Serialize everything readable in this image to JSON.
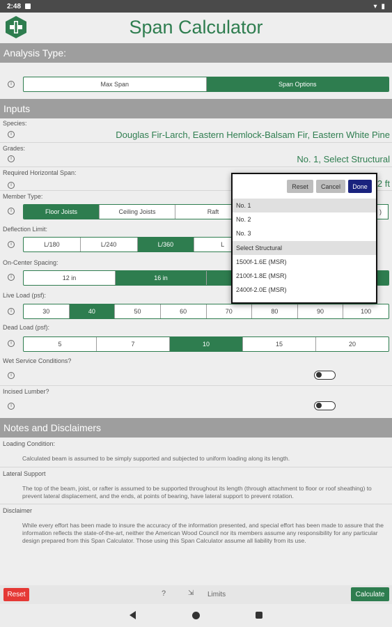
{
  "status": {
    "time": "2:48"
  },
  "app": {
    "title": "Span Calculator"
  },
  "sections": {
    "analysis": "Analysis Type:",
    "inputs": "Inputs",
    "notes": "Notes and Disclaimers"
  },
  "analysis_type": {
    "options": [
      "Max Span",
      "Span Options"
    ],
    "selected": "Span Options"
  },
  "species": {
    "label": "Species:",
    "value": "Douglas Fir-Larch, Eastern Hemlock-Balsam Fir, Eastern White Pine"
  },
  "grades": {
    "label": "Grades:",
    "value": "No. 1, Select Structural"
  },
  "horizontal_span": {
    "label": "Required Horizontal Span:",
    "value_suffix": "2 ft"
  },
  "member_type": {
    "label": "Member Type:",
    "options": [
      "Floor Joists",
      "Ceiling Joists",
      "Raft"
    ],
    "selected": "Floor Joists",
    "trailing_partial": ")"
  },
  "deflection": {
    "label": "Deflection Limit:",
    "options": [
      "L/180",
      "L/240",
      "L/360",
      "L"
    ],
    "selected": "L/360"
  },
  "spacing": {
    "label": "On-Center Spacing:",
    "options": [
      "12 in",
      "16 in"
    ],
    "selected": "16 in"
  },
  "live_load": {
    "label": "Live Load (psf):",
    "options": [
      "30",
      "40",
      "50",
      "60",
      "70",
      "80",
      "90",
      "100"
    ],
    "selected": "40"
  },
  "dead_load": {
    "label": "Dead Load (psf):",
    "options": [
      "5",
      "7",
      "10",
      "15",
      "20"
    ],
    "selected": "10"
  },
  "wet_service": {
    "label": "Wet Service Conditions?",
    "on": false
  },
  "incised": {
    "label": "Incised Lumber?",
    "on": false
  },
  "notes": [
    {
      "title": "Loading Condition:",
      "text": "Calculated beam is assumed to be simply supported and subjected to uniform loading along its length."
    },
    {
      "title": "Lateral Support",
      "text": "The top of the beam, joist, or rafter is assumed to be supported throughout its length (through attachment to floor or roof sheathing) to prevent lateral displacement, and the ends, at points of bearing, have lateral support to prevent rotation."
    },
    {
      "title": "Disclaimer",
      "text": "While every effort has been made to insure the accuracy of the information presented, and special effort has been made to assure that the information reflects the state-of-the-art, neither the American Wood Council nor its members assume any responsibility for any particular design prepared from this Span Calculator. Those using this Span Calculator assume all liability from its use."
    }
  ],
  "bottom": {
    "reset": "Reset",
    "help": "?",
    "limits": "Limits",
    "calculate": "Calculate"
  },
  "popup": {
    "reset": "Reset",
    "cancel": "Cancel",
    "done": "Done",
    "items": [
      {
        "label": "No. 1",
        "selected": true
      },
      {
        "label": "No. 2",
        "selected": false
      },
      {
        "label": "No. 3",
        "selected": false
      },
      {
        "label": "Select Structural",
        "selected": true
      },
      {
        "label": "1500f-1.6E (MSR)",
        "selected": false
      },
      {
        "label": "2100f-1.8E (MSR)",
        "selected": false
      },
      {
        "label": "2400f-2.0E (MSR)",
        "selected": false
      }
    ]
  },
  "colors": {
    "accent": "#2e7d4f",
    "header": "#9e9e9e",
    "reset_red": "#e53935",
    "done_navy": "#1a237e"
  },
  "icons": [
    "logo-icon",
    "info-icon",
    "help-icon",
    "limits-icon",
    "nav-back-icon",
    "nav-home-icon",
    "nav-recent-icon"
  ]
}
